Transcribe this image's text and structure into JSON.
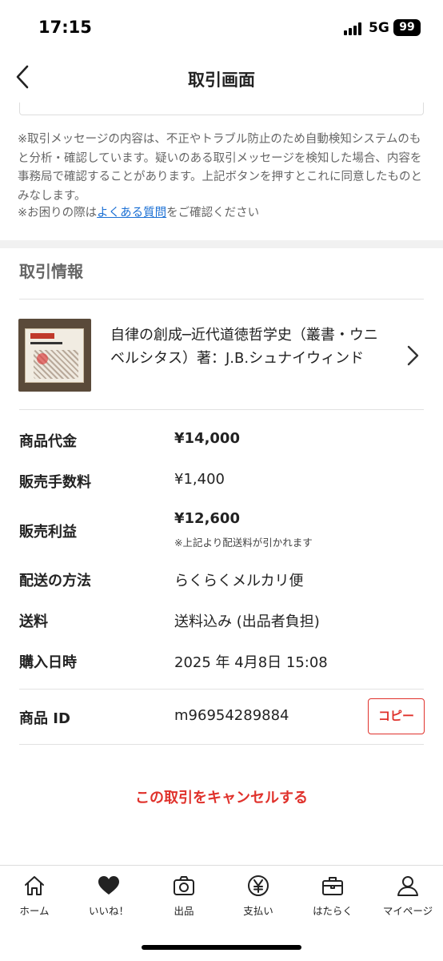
{
  "status_bar": {
    "time": "17:15",
    "network": "5G",
    "battery": "99"
  },
  "nav": {
    "title": "取引画面"
  },
  "notice": {
    "text": "※取引メッセージの内容は、不正やトラブル防止のため自動検知システムのもと分析・確認しています。疑いのある取引メッセージを検知した場合、内容を事務局で確認することがあります。上記ボタンを押すとこれに同意したものとみなします。",
    "help_prefix": "※お困りの際は",
    "help_link": "よくある質問",
    "help_suffix": "をご確認ください"
  },
  "section": {
    "title": "取引情報"
  },
  "item": {
    "title": "自律の創成─近代道徳哲学史（叢書・ウニベルシタス）著：J.B.シュナイウィンド"
  },
  "details": {
    "price_label": "商品代金",
    "price_value": "¥14,000",
    "fee_label": "販売手数料",
    "fee_value": "¥1,400",
    "profit_label": "販売利益",
    "profit_value": "¥12,600",
    "profit_note": "※上記より配送料が引かれます",
    "shipping_method_label": "配送の方法",
    "shipping_method_value": "らくらくメルカリ便",
    "shipping_fee_label": "送料",
    "shipping_fee_value": "送料込み (出品者負担)",
    "purchase_date_label": "購入日時",
    "purchase_date_value": "2025 年 4月8日 15:08",
    "item_id_label": "商品 ID",
    "item_id_value": "m96954289884",
    "copy_label": "コピー"
  },
  "cancel_label": "この取引をキャンセルする",
  "tabbar": {
    "items": [
      {
        "label": "ホーム",
        "icon": "home-icon"
      },
      {
        "label": "いいね！",
        "icon": "heart-icon"
      },
      {
        "label": "出品",
        "icon": "camera-icon"
      },
      {
        "label": "支払い",
        "icon": "yen-icon"
      },
      {
        "label": "はたらく",
        "icon": "briefcase-icon"
      },
      {
        "label": "マイページ",
        "icon": "person-icon"
      }
    ]
  },
  "colors": {
    "accent": "#e0322c",
    "link": "#1a6fd4"
  }
}
